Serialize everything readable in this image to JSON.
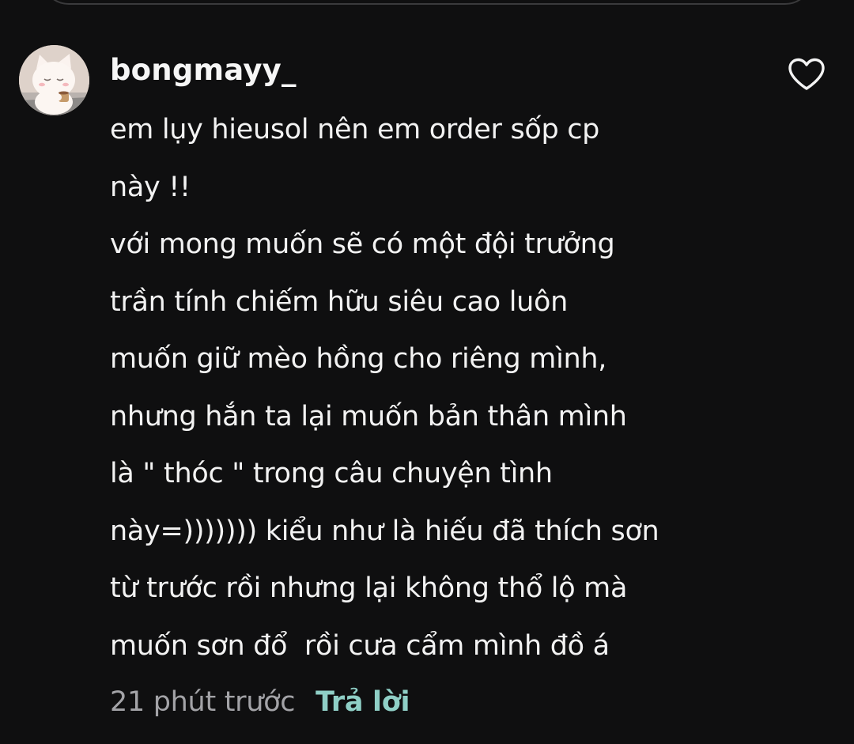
{
  "comment": {
    "username": "bongmayy_",
    "avatar_icon": "cat-avatar-icon",
    "like_icon": "heart-outline-icon",
    "lines": [
      "em lụy hieusol nên em order sốp cp",
      "này !!",
      "với mong muốn sẽ có một đội trưởng",
      "trần tính chiếm hữu siêu cao luôn",
      "muốn giữ mèo hồng cho riêng mình,",
      "nhưng hắn ta lại muốn bản thân mình",
      "là \" thóc \" trong câu chuyện tình",
      "này=))))))) kiểu như là hiếu đã thích sơn",
      "từ trước rồi nhưng lại không thổ lộ mà",
      "muốn sơn đổ  rồi cưa cẩm mình đồ á"
    ],
    "timestamp": "21 phút trước",
    "reply_label": "Trả lời"
  },
  "colors": {
    "background": "#0f0f10",
    "text": "#f2f2f2",
    "muted": "#a3a3a7",
    "reply_accent": "#8fcfc6"
  }
}
